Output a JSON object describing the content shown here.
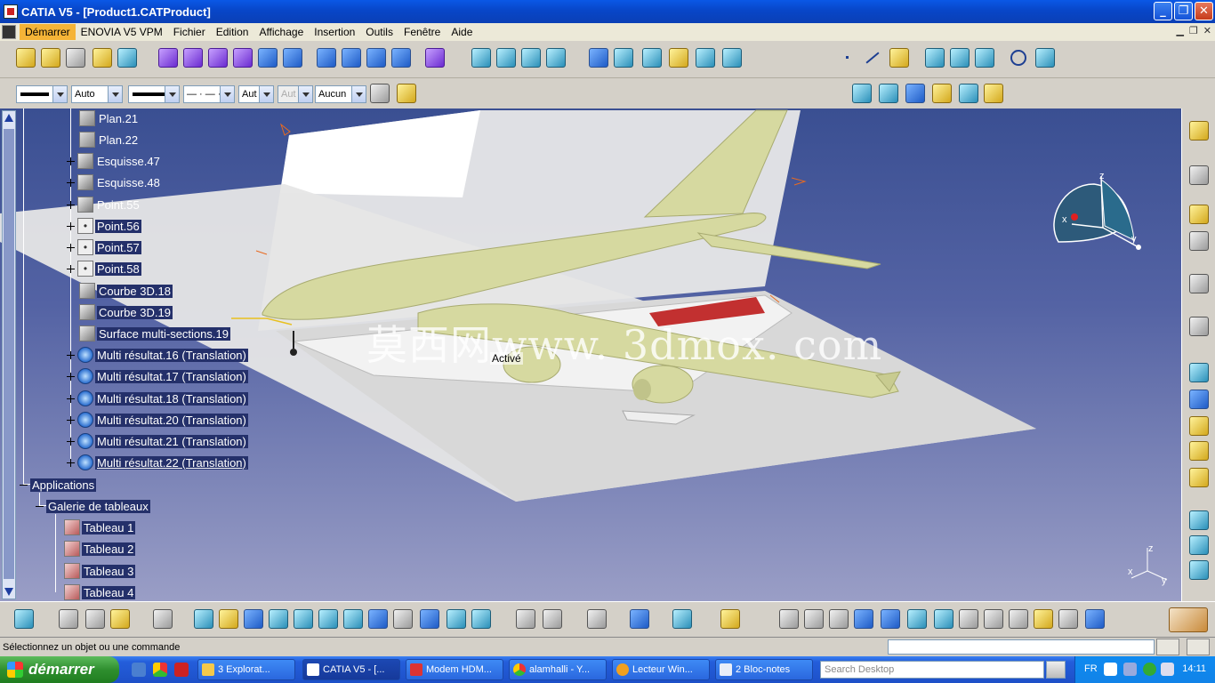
{
  "window": {
    "title": "CATIA V5 - [Product1.CATProduct]",
    "buttons": {
      "minimize": "_",
      "restore": "❐",
      "close": "✕"
    }
  },
  "menu": {
    "items": [
      "Démarrer",
      "ENOVIA V5 VPM",
      "Fichier",
      "Edition",
      "Affichage",
      "Insertion",
      "Outils",
      "Fenêtre",
      "Aide"
    ]
  },
  "properties_toolbar": {
    "color_combo": "",
    "transparency_combo": "Auto",
    "line_weight_combo": "",
    "line_type_combo": "— · — ·",
    "point_type_combo": "Aut",
    "layer_disabled_combo": "Aut",
    "layer_combo": "Aucun"
  },
  "tree": {
    "items": [
      {
        "label": "Plan.21",
        "icon": "plane-icon"
      },
      {
        "label": "Plan.22",
        "icon": "plane-icon"
      },
      {
        "label": "Esquisse.47",
        "icon": "sketch-icon"
      },
      {
        "label": "Esquisse.48",
        "icon": "sketch-icon"
      },
      {
        "label": "Point.55",
        "icon": "point-icon"
      },
      {
        "label": "Point.56",
        "icon": "point-icon"
      },
      {
        "label": "Point.57",
        "icon": "point-icon"
      },
      {
        "label": "Point.58",
        "icon": "point-icon"
      },
      {
        "label": "Courbe 3D.18",
        "icon": "curve-icon"
      },
      {
        "label": "Courbe 3D.19",
        "icon": "curve-icon"
      },
      {
        "label": "Surface multi-sections.19",
        "icon": "surface-icon"
      },
      {
        "label": "Multi résultat.16 (Translation)",
        "icon": "multi-result-icon"
      },
      {
        "label": "Multi résultat.17 (Translation)",
        "icon": "multi-result-icon"
      },
      {
        "label": "Multi résultat.18 (Translation)",
        "icon": "multi-result-icon"
      },
      {
        "label": "Multi résultat.20 (Translation)",
        "icon": "multi-result-icon"
      },
      {
        "label": "Multi résultat.21 (Translation)",
        "icon": "multi-result-icon"
      },
      {
        "label": "Multi résultat.22 (Translation)",
        "icon": "multi-result-icon"
      }
    ],
    "applications": "Applications",
    "gallery": "Galerie de tableaux",
    "tables": [
      "Tableau 1",
      "Tableau 2",
      "Tableau 3",
      "Tableau 4"
    ]
  },
  "viewport": {
    "watermark": "莫西网www. 3dmox. com",
    "active_tag": "Activé",
    "compass_labels": {
      "x": "x",
      "y": "y",
      "z": "z"
    },
    "axis_labels": {
      "x": "x",
      "y": "y",
      "z": "z"
    }
  },
  "statusbar": {
    "message": "Sélectionnez un objet ou une commande"
  },
  "taskbar": {
    "start": "démarrer",
    "tasks": [
      {
        "label": "3 Explorat...",
        "icon": "folder-icon"
      },
      {
        "label": "CATIA V5 - [...",
        "icon": "catia-icon"
      },
      {
        "label": "Modem HDM...",
        "icon": "modem-icon"
      },
      {
        "label": "alamhalli - Y...",
        "icon": "chrome-icon"
      },
      {
        "label": "Lecteur Win...",
        "icon": "media-player-icon"
      },
      {
        "label": "2 Bloc-notes",
        "icon": "notepad-icon"
      }
    ],
    "search_placeholder": "Search Desktop",
    "language": "FR",
    "clock": "14:11"
  },
  "colors": {
    "viewport_top": "#3a4f92",
    "viewport_bottom": "#9a9ec6",
    "aircraft": "#d6d9a0",
    "taskbar": "#245edb",
    "start_button": "#2f8f2f"
  }
}
